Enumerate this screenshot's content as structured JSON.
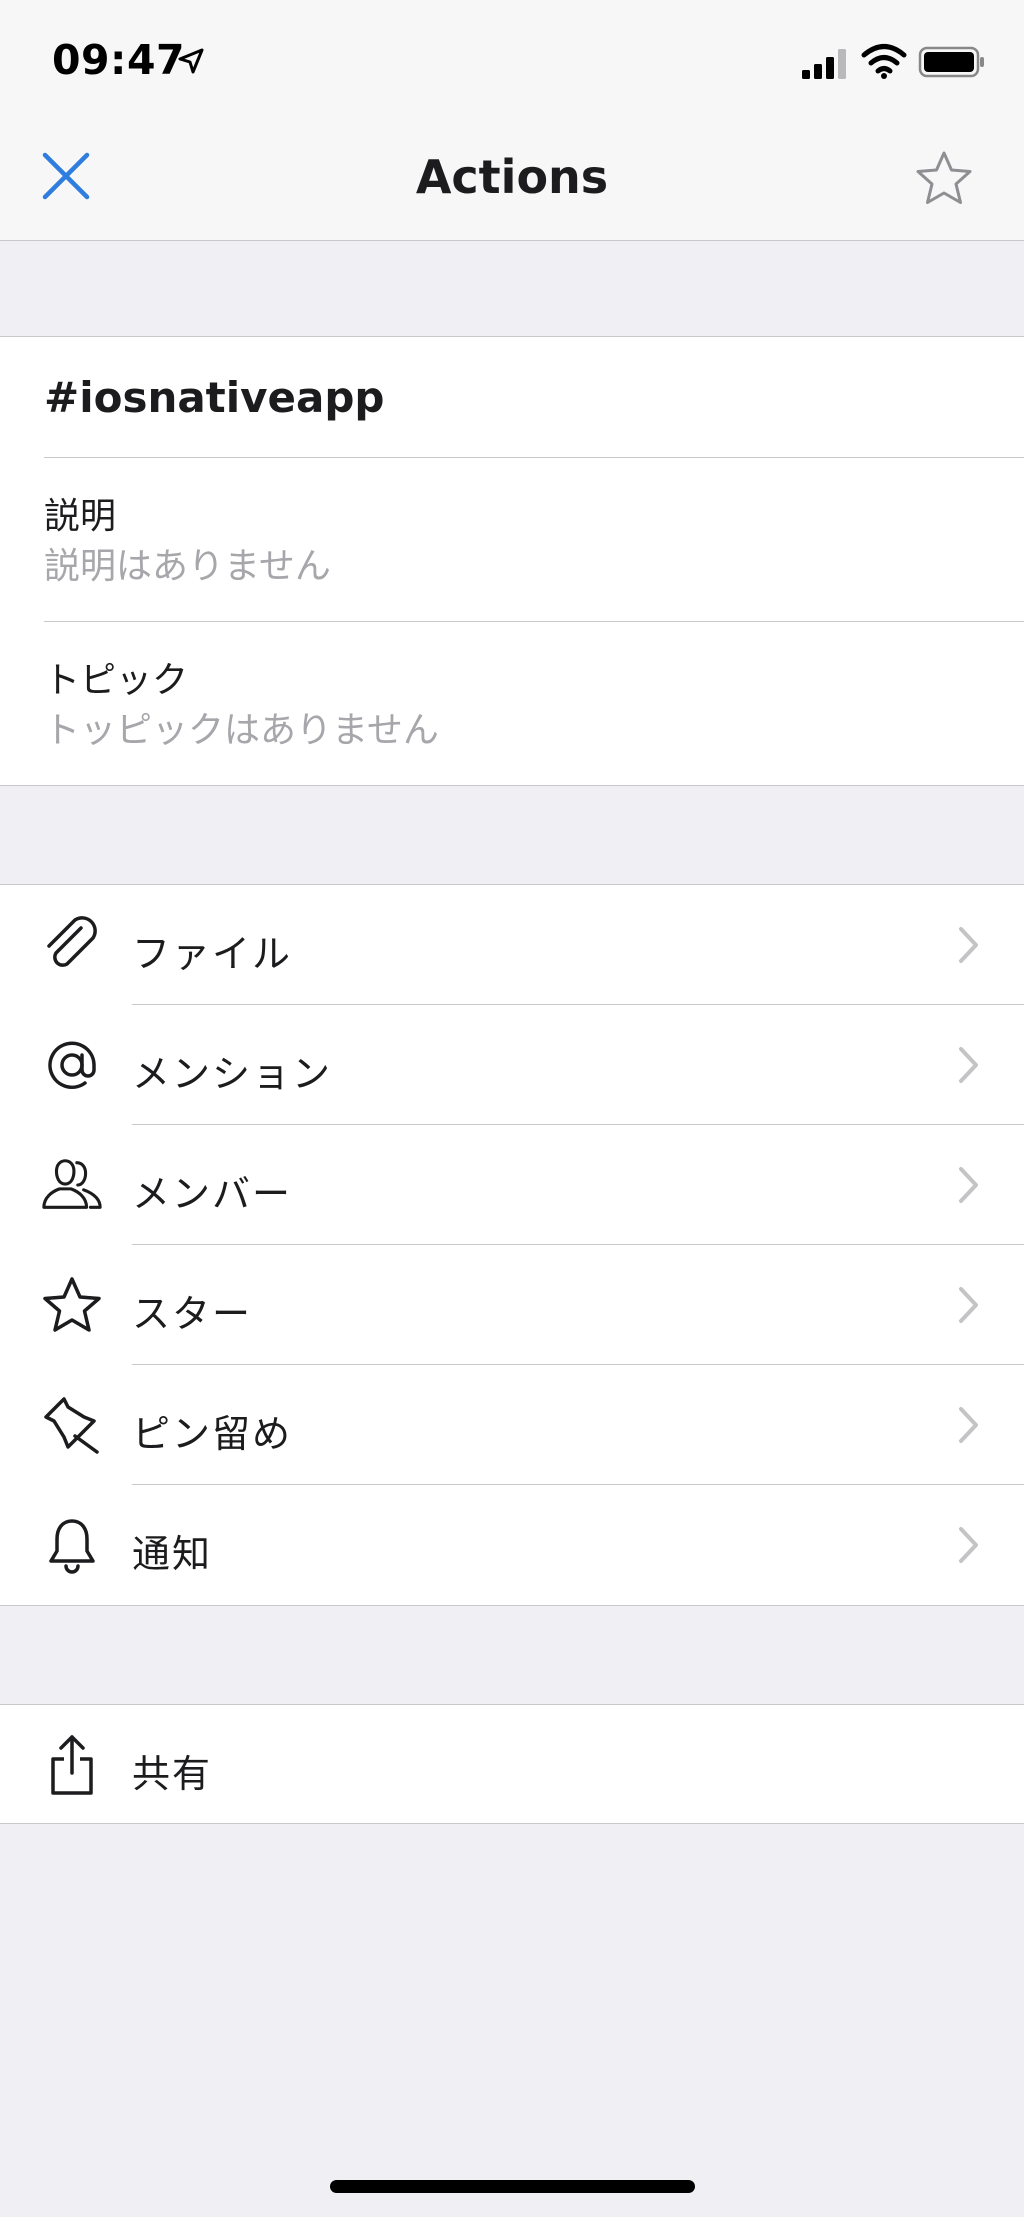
{
  "status_bar": {
    "time": "09:47",
    "icons": [
      "location-arrow-icon",
      "cellular-signal-icon",
      "wifi-icon",
      "battery-icon"
    ]
  },
  "nav": {
    "title": "Actions",
    "close_icon": "close-icon",
    "favorite_icon": "star-outline-icon"
  },
  "channel": {
    "name": "#iosnativeapp",
    "description_label": "説明",
    "description_value": "説明はありません",
    "topic_label": "トピック",
    "topic_value": "トッピックはありません"
  },
  "actions": [
    {
      "label": "ファイル",
      "icon": "paperclip-icon"
    },
    {
      "label": "メンション",
      "icon": "at-sign-icon"
    },
    {
      "label": "メンバー",
      "icon": "members-icon"
    },
    {
      "label": "スター",
      "icon": "star-icon"
    },
    {
      "label": "ピン留め",
      "icon": "pin-icon"
    },
    {
      "label": "通知",
      "icon": "bell-icon"
    }
  ],
  "share": {
    "label": "共有",
    "icon": "share-icon"
  },
  "colors": {
    "accent": "#2f7dde",
    "background": "#efeff4",
    "secondary_text": "#a6a6ab",
    "separator": "#c8c7cc"
  }
}
